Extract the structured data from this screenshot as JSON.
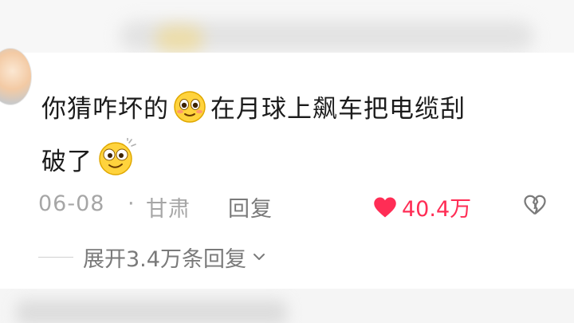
{
  "comment": {
    "text_part1": "你猜咋坏的",
    "emoji1": "smiling-face-emoji",
    "text_part2": "在月球上飙车把电缆刮",
    "text_part3": "破了",
    "emoji2": "dizzy-face-emoji"
  },
  "meta": {
    "date": "06-08",
    "separator": "·",
    "location": "甘肃",
    "reply_label": "回复",
    "likes": "40.4万",
    "like_color": "#ff2d55"
  },
  "replies": {
    "expand_label": "展开3.4万条回复"
  }
}
